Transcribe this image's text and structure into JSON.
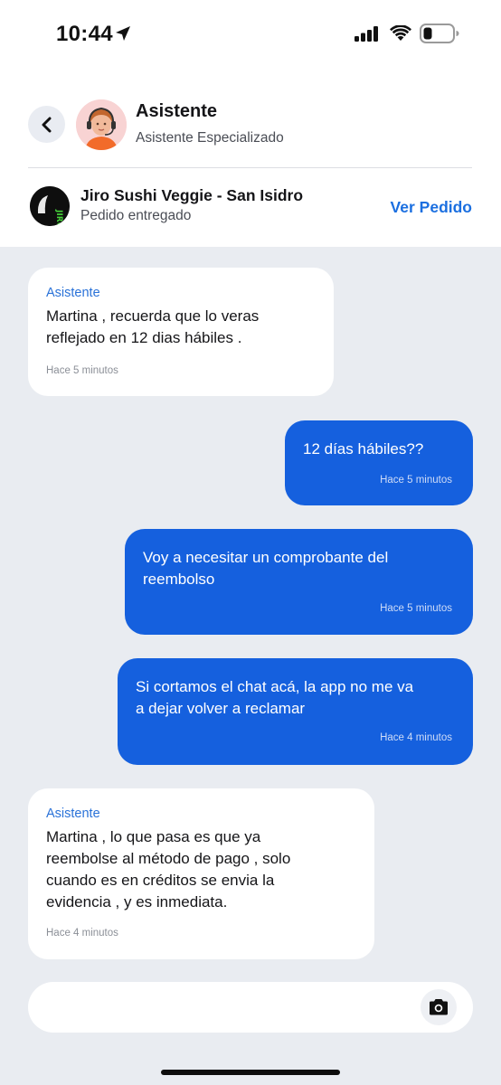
{
  "status_bar": {
    "time": "10:44"
  },
  "header": {
    "name": "Asistente",
    "subtitle": "Asistente Especializado"
  },
  "store": {
    "logo_text": "JIRO",
    "name": "Jiro Sushi Veggie - San Isidro",
    "status": "Pedido entregado",
    "action_label": "Ver Pedido"
  },
  "messages": [
    {
      "direction": "in",
      "sender": "Asistente",
      "text": "Martina , recuerda que lo veras\nreflejado en 12 dias hábiles .",
      "time": "Hace 5 minutos"
    },
    {
      "direction": "out",
      "text": "12 días hábiles??",
      "time": "Hace 5 minutos"
    },
    {
      "direction": "out",
      "text": "Voy a necesitar un comprobante del\nreembolso",
      "time": "Hace 5 minutos"
    },
    {
      "direction": "out",
      "text": "Si cortamos el chat acá, la app no me va\na dejar volver a reclamar",
      "time": "Hace 4 minutos"
    },
    {
      "direction": "in",
      "sender": "Asistente",
      "text": "Martina , lo que pasa es que ya\nreembolse al método de pago , solo\ncuando es en créditos se envia la\nevidencia , y es inmediata.",
      "time": "Hace 4 minutos"
    }
  ],
  "composer": {
    "value": "",
    "placeholder": "",
    "camera_icon": "camera-icon"
  },
  "colors": {
    "accent": "#1b6fe0",
    "outgoing_bubble": "#1560de",
    "incoming_bubble": "#ffffff",
    "chat_background": "#e9ecf1"
  }
}
